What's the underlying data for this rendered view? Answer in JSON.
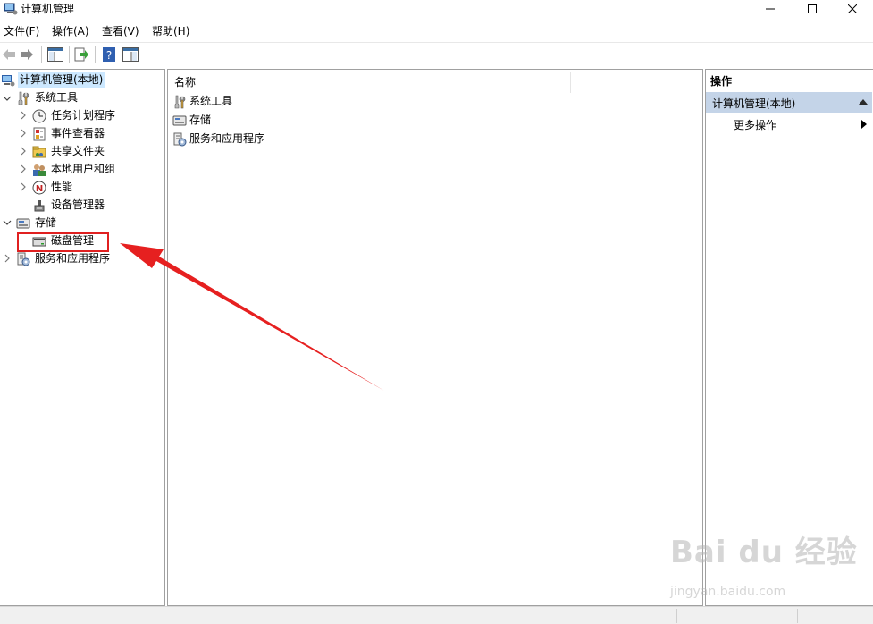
{
  "window": {
    "title": "计算机管理",
    "icon": "computer-management-icon",
    "controls": [
      "minimize-icon",
      "maximize-icon",
      "close-icon"
    ]
  },
  "menu": {
    "file": "文件(F)",
    "action": "操作(A)",
    "view": "查看(V)",
    "help": "帮助(H)"
  },
  "toolbar": {
    "buttons": [
      "back-arrow-icon",
      "forward-arrow-icon",
      "show-hide-tree-icon",
      "export-list-icon",
      "help-icon",
      "properties-pane-icon"
    ]
  },
  "tree": {
    "root": "计算机管理(本地)",
    "system_tools": "系统工具",
    "task_scheduler": "任务计划程序",
    "event_viewer": "事件查看器",
    "shared_folders": "共享文件夹",
    "local_users": "本地用户和组",
    "performance": "性能",
    "device_manager": "设备管理器",
    "storage": "存储",
    "disk_management": "磁盘管理",
    "services_apps": "服务和应用程序"
  },
  "list": {
    "column_name": "名称",
    "items": [
      "系统工具",
      "存储",
      "服务和应用程序"
    ]
  },
  "actions": {
    "title": "操作",
    "section": "计算机管理(本地)",
    "more": "更多操作"
  },
  "annotation": {
    "box_color": "#e02020",
    "arrow_color": "#e62020"
  },
  "watermark": {
    "logo": "Bai du 经验",
    "url": "jingyan.baidu.com"
  }
}
